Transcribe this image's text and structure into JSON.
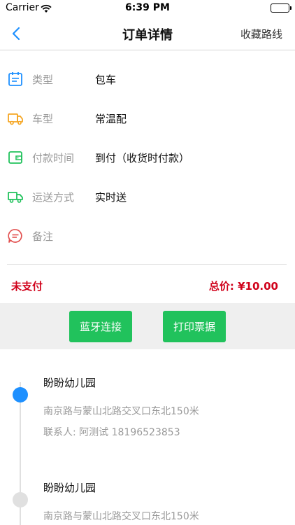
{
  "status_bar": {
    "carrier": "Carrier",
    "time": "6:39 PM"
  },
  "nav": {
    "title": "订单详情",
    "right_action": "收藏路线"
  },
  "details": [
    {
      "icon": "calendar-icon",
      "label": "类型",
      "value": "包车",
      "color": "#1e90ff"
    },
    {
      "icon": "truck-icon",
      "label": "车型",
      "value": "常温配",
      "color": "#f5a623"
    },
    {
      "icon": "wallet-icon",
      "label": "付款时间",
      "value": "到付（收货时付款）",
      "color": "#21c25c"
    },
    {
      "icon": "delivery-truck-icon",
      "label": "运送方式",
      "value": "实时送",
      "color": "#21c25c"
    },
    {
      "icon": "comment-icon",
      "label": "备注",
      "value": "",
      "color": "#e2504f"
    }
  ],
  "payment": {
    "status": "未支付",
    "total": "总价: ¥10.00",
    "color": "#d0021b"
  },
  "actions": {
    "bluetooth_label": "蓝牙连接",
    "print_label": "打印票据",
    "color": "#21c25c"
  },
  "route": [
    {
      "name": "盼盼幼儿园",
      "address": "南京路与蒙山北路交叉口东北150米",
      "contact": "联系人: 阿测试 18196523853",
      "dot_color": "#1e90ff"
    },
    {
      "name": "盼盼幼儿园",
      "address": "南京路与蒙山北路交叉口东北150米",
      "contact": "",
      "dot_color": "#e0e0e0"
    }
  ]
}
